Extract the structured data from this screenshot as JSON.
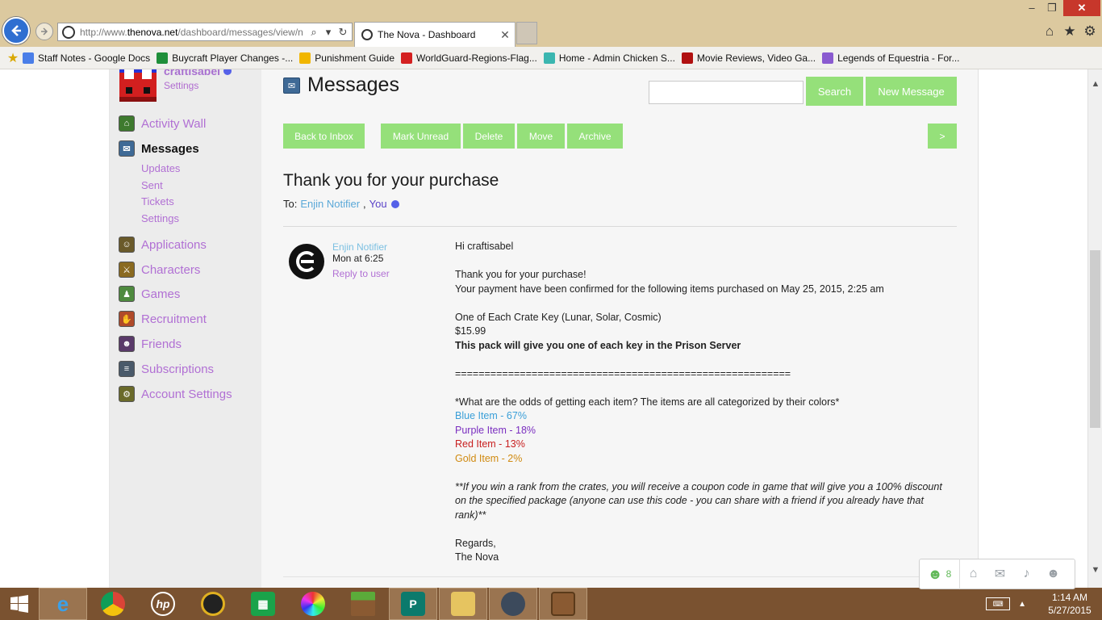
{
  "browser": {
    "url_prefix": "http://www.",
    "url_domain": "thenova.net",
    "url_path": "/dashboard/messages/view/n",
    "tab_title": "The Nova - Dashboard",
    "favorites": [
      {
        "label": "Staff Notes - Google Docs",
        "color": "#4a7ee8"
      },
      {
        "label": "Buycraft Player Changes -...",
        "color": "#1f8f3a"
      },
      {
        "label": "Punishment Guide",
        "color": "#f1b600"
      },
      {
        "label": "WorldGuard-Regions-Flag...",
        "color": "#d42020"
      },
      {
        "label": "Home - Admin Chicken S...",
        "color": "#3bb6b0"
      },
      {
        "label": "Movie Reviews, Video Ga...",
        "color": "#b01010"
      },
      {
        "label": "Legends of Equestria - For...",
        "color": "#8a5bd0"
      }
    ]
  },
  "sidebar": {
    "username": "craftisabel",
    "user_settings": "Settings",
    "items": [
      {
        "label": "Activity Wall",
        "icon": "home-icon",
        "color": "#3e7a2e"
      },
      {
        "label": "Messages",
        "icon": "envelope-icon",
        "color": "#3f6a96"
      },
      {
        "label": "Applications",
        "icon": "applications-icon",
        "color": "#6a5a2a"
      },
      {
        "label": "Characters",
        "icon": "characters-icon",
        "color": "#8a6a20"
      },
      {
        "label": "Games",
        "icon": "games-icon",
        "color": "#4e8a3e"
      },
      {
        "label": "Recruitment",
        "icon": "recruitment-icon",
        "color": "#b04a2a"
      },
      {
        "label": "Friends",
        "icon": "friends-icon",
        "color": "#5a3a6a"
      },
      {
        "label": "Subscriptions",
        "icon": "subscriptions-icon",
        "color": "#4a5a6a"
      },
      {
        "label": "Account Settings",
        "icon": "account-settings-icon",
        "color": "#6a6a2a"
      }
    ],
    "sub_items": [
      "Updates",
      "Sent",
      "Tickets",
      "Settings"
    ]
  },
  "main": {
    "title": "Messages",
    "search_label": "Search",
    "new_message_label": "New Message",
    "toolbar": {
      "back": "Back to Inbox",
      "mark_unread": "Mark Unread",
      "delete": "Delete",
      "move": "Move",
      "archive": "Archive",
      "next": ">"
    },
    "subject": "Thank you for your purchase",
    "to_label": "To:",
    "to_sender": "Enjin Notifier",
    "to_sep": ",",
    "to_you": "You",
    "sender": {
      "name": "Enjin Notifier",
      "time": "Mon at 6:25",
      "reply": "Reply to user"
    },
    "body": {
      "greeting": "Hi craftisabel",
      "thanks": "Thank you for your purchase!",
      "confirmed": "Your payment have been confirmed for the following items purchased on May 25, 2015, 2:25 am",
      "item": "One of Each Crate Key (Lunar, Solar, Cosmic)",
      "price": "$15.99",
      "pack_note": "This pack will give you one of each key in the Prison Server",
      "separator": "=========================================================",
      "odds": "*What are the odds of getting each item? The items are all categorized by their colors*",
      "blue": {
        "text": "Blue Item - 67%",
        "color": "#3a9fd8"
      },
      "purple": {
        "text": "Purple Item - 18%",
        "color": "#7b2fc0"
      },
      "red": {
        "text": "Red Item - 13%",
        "color": "#c82020"
      },
      "gold": {
        "text": "Gold Item - 2%",
        "color": "#d08a10"
      },
      "coupon": "**If you win a rank from the crates, you will receive a coupon code in game that will give you a 100% discount on the specified package (anyone can use this code - you can share with a friend if you already have that rank)**",
      "regards": "Regards,",
      "signature": "The Nova"
    }
  },
  "float_bar": {
    "friend_count": "8"
  },
  "taskbar": {
    "time": "1:14 AM",
    "date": "5/27/2015"
  },
  "accent_green": "#95e07a"
}
